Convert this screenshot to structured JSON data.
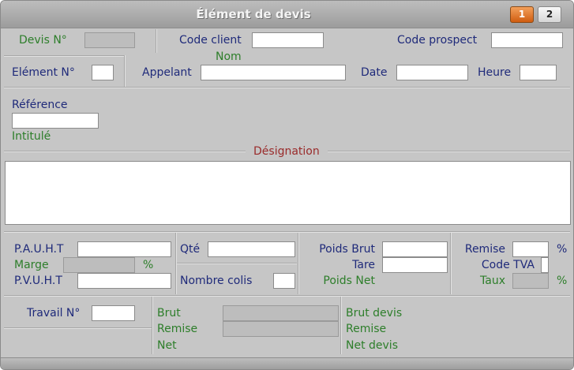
{
  "window": {
    "title": "Élément de devis"
  },
  "pages": [
    "1",
    "2"
  ],
  "header": {
    "devis_no_label": "Devis N°",
    "code_client_label": "Code client",
    "nom_label": "Nom",
    "code_prospect_label": "Code prospect"
  },
  "row2": {
    "element_no_label": "Elément N°",
    "appelant_label": "Appelant",
    "date_label": "Date",
    "heure_label": "Heure"
  },
  "reference": {
    "reference_label": "Référence",
    "intitule_label": "Intitulé",
    "designation_label": "Désignation"
  },
  "prices": {
    "pauht_label": "P.A.U.H.T",
    "marge_label": "Marge",
    "marge_unit": "%",
    "pvuht_label": "P.V.U.H.T",
    "qte_label": "Qté",
    "nombre_colis_label": "Nombre colis",
    "poids_brut_label": "Poids Brut",
    "tare_label": "Tare",
    "poids_net_label": "Poids Net",
    "remise_label": "Remise",
    "remise_unit": "%",
    "code_tva_label": "Code TVA",
    "taux_label": "Taux",
    "taux_unit": "%"
  },
  "totals": {
    "travail_no_label": "Travail N°",
    "brut_label": "Brut",
    "remise_label": "Remise",
    "net_label": "Net",
    "brut_devis_label": "Brut devis",
    "remise_devis_label": "Remise",
    "net_devis_label": "Net devis"
  }
}
